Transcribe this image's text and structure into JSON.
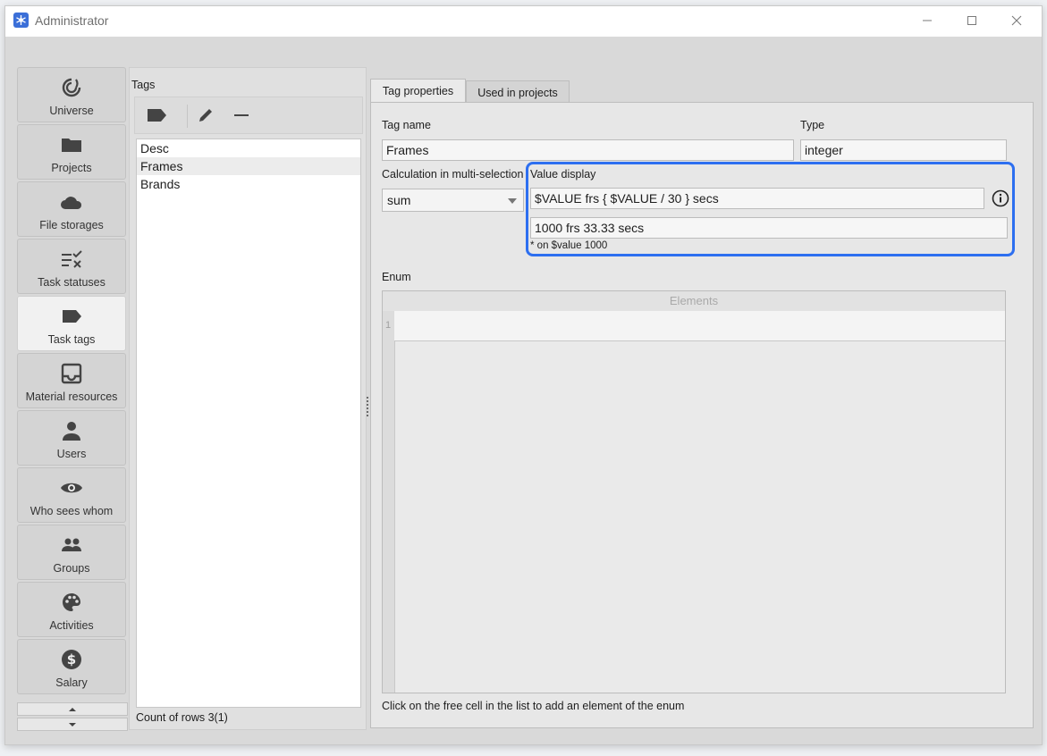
{
  "window": {
    "title": "Administrator"
  },
  "sidebar": {
    "items": [
      {
        "label": "Universe",
        "icon": "universe-icon"
      },
      {
        "label": "Projects",
        "icon": "folder-icon"
      },
      {
        "label": "File storages",
        "icon": "cloud-icon"
      },
      {
        "label": "Task statuses",
        "icon": "status-list-icon"
      },
      {
        "label": "Task tags",
        "icon": "tag-icon",
        "active": true
      },
      {
        "label": "Material resources",
        "icon": "inbox-icon"
      },
      {
        "label": "Users",
        "icon": "user-icon"
      },
      {
        "label": "Who sees whom",
        "icon": "eye-icon"
      },
      {
        "label": "Groups",
        "icon": "group-icon"
      },
      {
        "label": "Activities",
        "icon": "palette-icon"
      },
      {
        "label": "Salary",
        "icon": "dollar-icon"
      }
    ]
  },
  "tags_panel": {
    "title": "Tags",
    "rows": [
      "Desc",
      "Frames",
      "Brands"
    ],
    "selected_row": "Frames",
    "count": "Count of rows 3(1)"
  },
  "tabs": [
    {
      "label": "Tag properties",
      "active": true
    },
    {
      "label": "Used in projects",
      "active": false
    }
  ],
  "properties": {
    "tag_name_label": "Tag name",
    "tag_name_value": "Frames",
    "type_label": "Type",
    "type_value": "integer",
    "calc_label": "Calculation in multi-selection",
    "calc_value": "sum",
    "value_display_label": "Value display",
    "value_display_value": "$VALUE frs { $VALUE / 30 } secs",
    "preview_value": "1000 frs 33.33 secs",
    "preview_note": "* on $value 1000",
    "enum_label": "Enum",
    "elements_header": "Elements",
    "row_number": "1",
    "hint": "Click on the free cell in the list to add an element of the enum"
  },
  "colors": {
    "accent": "#2d6ff0",
    "app_icon": "#3b6fd8"
  }
}
